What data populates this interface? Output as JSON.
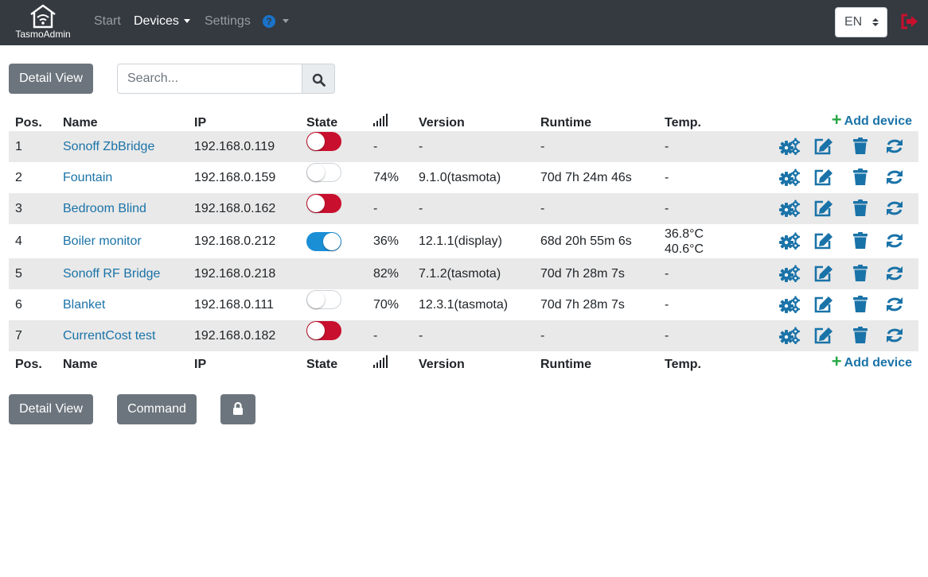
{
  "nav": {
    "brand": "TasmoAdmin",
    "start": "Start",
    "devices": "Devices",
    "settings": "Settings",
    "help_glyph": "?",
    "language": "EN"
  },
  "toolbar": {
    "detail_view": "Detail View",
    "search_placeholder": "Search..."
  },
  "table": {
    "headers": {
      "pos": "Pos.",
      "name": "Name",
      "ip": "IP",
      "state": "State",
      "version": "Version",
      "runtime": "Runtime",
      "temp": "Temp.",
      "add_device": "Add device"
    },
    "rows": [
      {
        "pos": "1",
        "name": "Sonoff ZbBridge",
        "ip": "192.168.0.119",
        "state": "red",
        "signal": "-",
        "version": "-",
        "runtime": "-",
        "temp": "-",
        "temp2": ""
      },
      {
        "pos": "2",
        "name": "Fountain",
        "ip": "192.168.0.159",
        "state": "off",
        "signal": "74%",
        "version": "9.1.0(tasmota)",
        "runtime": "70d 7h 24m 46s",
        "temp": "-",
        "temp2": ""
      },
      {
        "pos": "3",
        "name": "Bedroom Blind",
        "ip": "192.168.0.162",
        "state": "red",
        "signal": "-",
        "version": "-",
        "runtime": "-",
        "temp": "-",
        "temp2": ""
      },
      {
        "pos": "4",
        "name": "Boiler monitor",
        "ip": "192.168.0.212",
        "state": "on",
        "signal": "36%",
        "version": "12.1.1(display)",
        "runtime": "68d 20h 55m 6s",
        "temp": "36.8°C",
        "temp2": "40.6°C"
      },
      {
        "pos": "5",
        "name": "Sonoff RF Bridge",
        "ip": "192.168.0.218",
        "state": "none",
        "signal": "82%",
        "version": "7.1.2(tasmota)",
        "runtime": "70d 7h 28m 7s",
        "temp": "-",
        "temp2": ""
      },
      {
        "pos": "6",
        "name": "Blanket",
        "ip": "192.168.0.111",
        "state": "off",
        "signal": "70%",
        "version": "12.3.1(tasmota)",
        "runtime": "70d 7h 28m 7s",
        "temp": "-",
        "temp2": ""
      },
      {
        "pos": "7",
        "name": "CurrentCost test",
        "ip": "192.168.0.182",
        "state": "red",
        "signal": "-",
        "version": "-",
        "runtime": "-",
        "temp": "-",
        "temp2": ""
      }
    ]
  },
  "bottom": {
    "detail_view": "Detail View",
    "command": "Command"
  },
  "colors": {
    "navbar": "#343a40",
    "link": "#1a73a8",
    "toggle_red": "#c8102e",
    "toggle_blue": "#1b8fd6",
    "add_plus": "#28a745",
    "logout": "#c8102e"
  },
  "icons": [
    "wifi-home-logo-icon",
    "help-circle-icon",
    "logout-icon",
    "search-icon",
    "signal-bars-icon",
    "plus-icon",
    "gears-icon",
    "edit-icon",
    "trash-icon",
    "refresh-icon",
    "lock-icon"
  ]
}
